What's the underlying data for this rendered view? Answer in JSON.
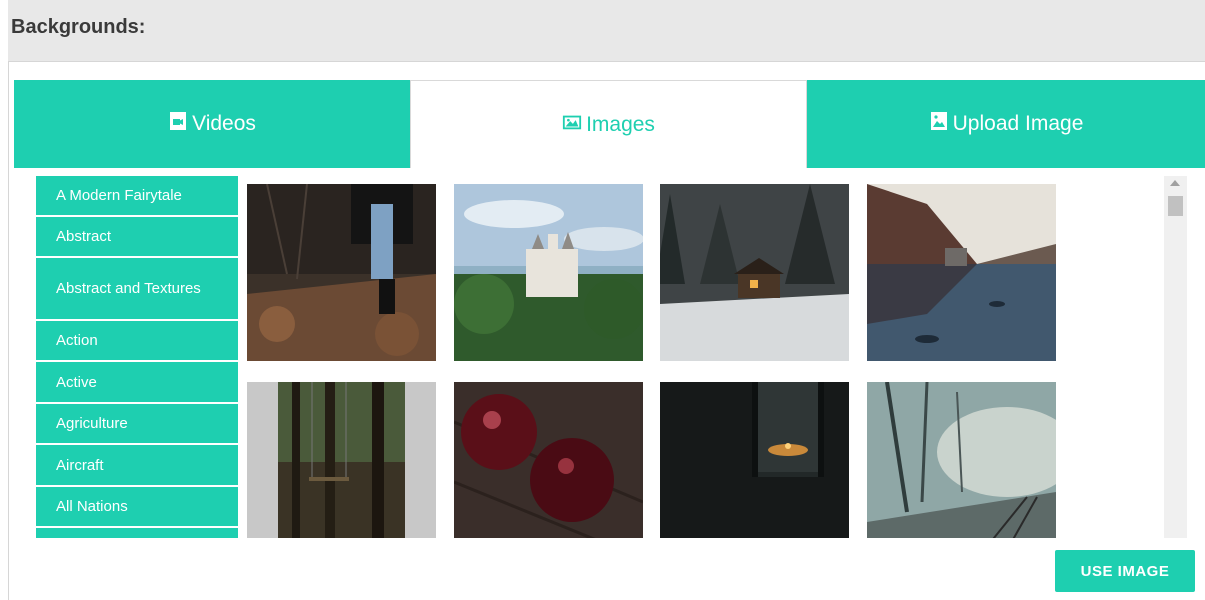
{
  "header": {
    "title": "Backgrounds:"
  },
  "tabs": [
    {
      "label": "Videos",
      "icon": "video-file-icon",
      "active": false
    },
    {
      "label": "Images",
      "icon": "image-icon",
      "active": true
    },
    {
      "label": "Upload Image",
      "icon": "image-file-icon",
      "active": false
    }
  ],
  "categories": [
    "A Modern Fairytale",
    "Abstract",
    "Abstract and Textures",
    "Action",
    "Active",
    "Agriculture",
    "Aircraft",
    "All Nations"
  ],
  "images": [
    {
      "subject": "forest-path-legs-photo"
    },
    {
      "subject": "castle-photo"
    },
    {
      "subject": "snowy-cabin-photo"
    },
    {
      "subject": "lake-boathouse-photo"
    },
    {
      "subject": "forest-swing-photo"
    },
    {
      "subject": "apples-photo"
    },
    {
      "subject": "lantern-photo"
    },
    {
      "subject": "misty-railway-photo"
    }
  ],
  "actions": {
    "use_image_label": "USE IMAGE"
  },
  "colors": {
    "accent": "#1ecfb0",
    "header_bg": "#e8e8e8"
  }
}
